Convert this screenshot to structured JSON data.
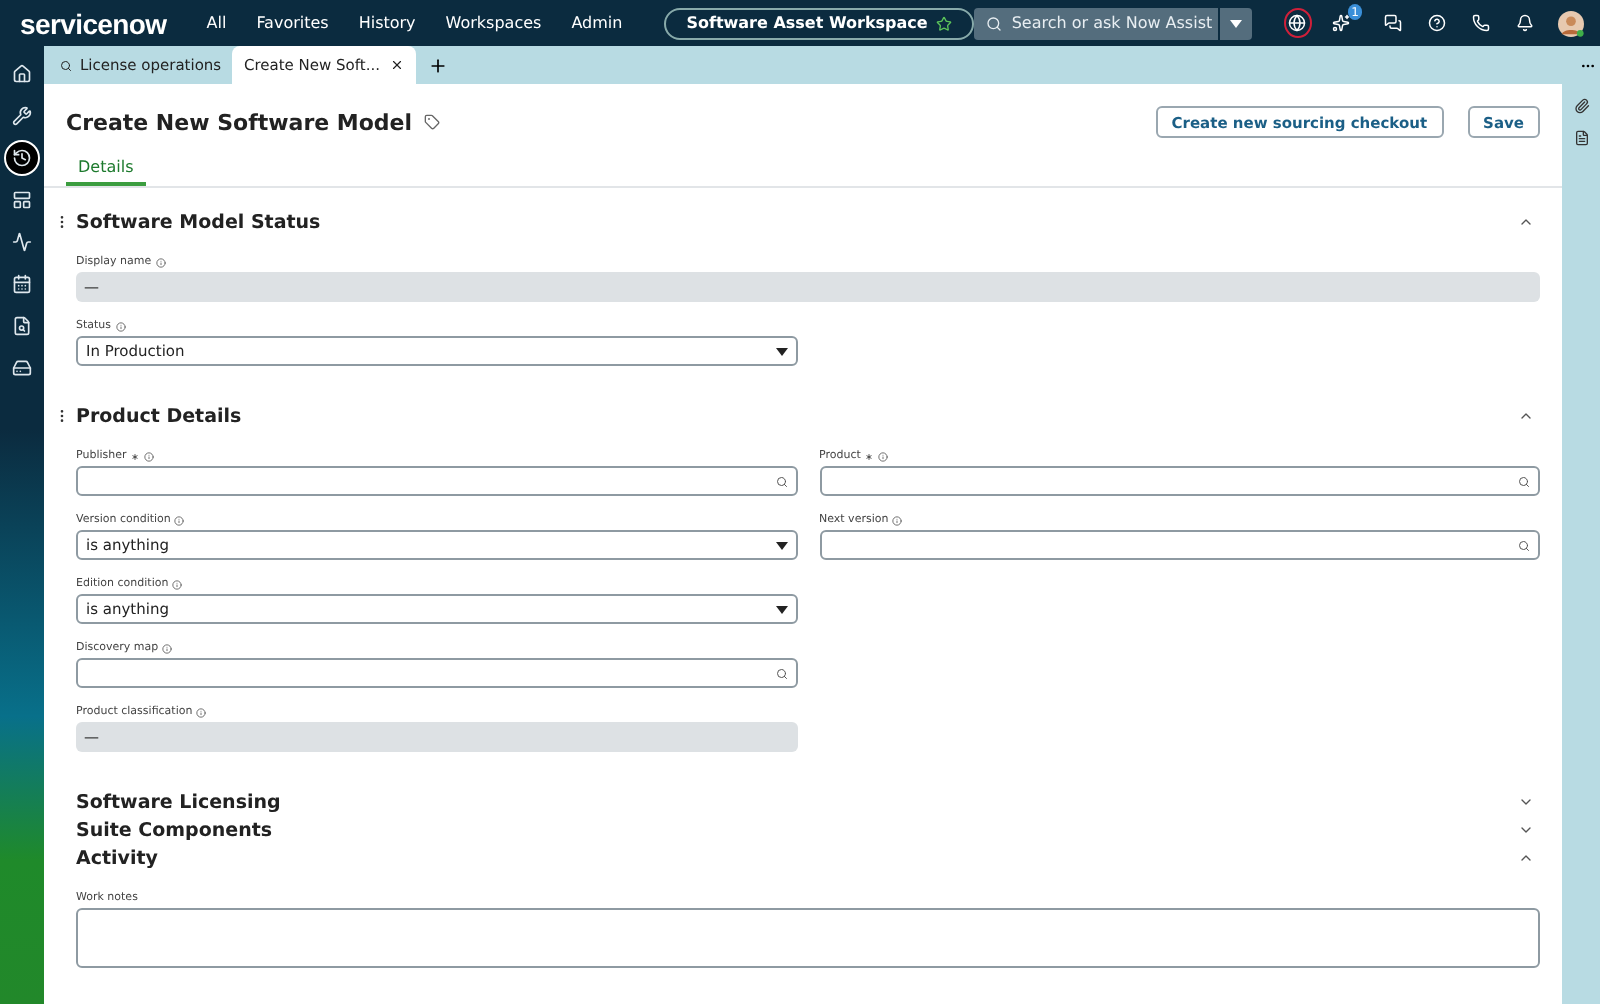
{
  "nav": {
    "brand": "servicenow",
    "menu": [
      "All",
      "Favorites",
      "History",
      "Workspaces",
      "Admin"
    ],
    "workspace": "Software Asset Workspace",
    "search_placeholder": "Search or ask Now Assist",
    "assist_badge": "1"
  },
  "sidebar": [
    {
      "selected": false
    },
    {
      "selected": false
    },
    {
      "selected": true
    },
    {
      "selected": false
    },
    {
      "selected": false
    },
    {
      "selected": false
    },
    {
      "selected": false
    },
    {
      "selected": false
    }
  ],
  "tabs": [
    {
      "label": "License operations",
      "selected": false,
      "closable": false
    },
    {
      "label": "Create New Soft...",
      "selected": true,
      "closable": true
    }
  ],
  "page": {
    "title": "Create New Software Model",
    "buttons": [
      "Create new sourcing checkout",
      "Save"
    ],
    "form_tabs": [
      {
        "label": "Details",
        "selected": true
      }
    ]
  },
  "sections": [
    {
      "title": "Software Model Status",
      "expanded": true,
      "fields": [
        {
          "label": "Display name",
          "kind": "readonly",
          "value": "—",
          "required": false,
          "wide": true
        },
        {
          "label": "Status",
          "kind": "select",
          "value": "In Production",
          "required": false,
          "wide": false
        }
      ]
    },
    {
      "title": "Product Details",
      "expanded": true,
      "columns": [
        [
          {
            "label": "Publisher",
            "kind": "lookup",
            "required": true
          },
          {
            "label": "Version condition",
            "kind": "select",
            "value": "is anything",
            "required": false
          },
          {
            "label": "Edition condition",
            "kind": "select",
            "value": "is anything",
            "required": false
          },
          {
            "label": "Discovery map",
            "kind": "lookup",
            "required": false
          },
          {
            "label": "Product classification",
            "kind": "readonly",
            "value": "—",
            "required": false
          }
        ],
        [
          {
            "label": "Product",
            "kind": "lookup",
            "required": true
          },
          {
            "label": "Next version",
            "kind": "lookup",
            "required": false
          }
        ]
      ]
    },
    {
      "title": "Software Licensing",
      "expanded": false
    },
    {
      "title": "Suite Components",
      "expanded": false
    },
    {
      "title": "Activity",
      "expanded": true,
      "fields": [
        {
          "label": "Work notes",
          "kind": "textarea",
          "required": false,
          "wide": true,
          "noinfo": true
        }
      ]
    }
  ]
}
